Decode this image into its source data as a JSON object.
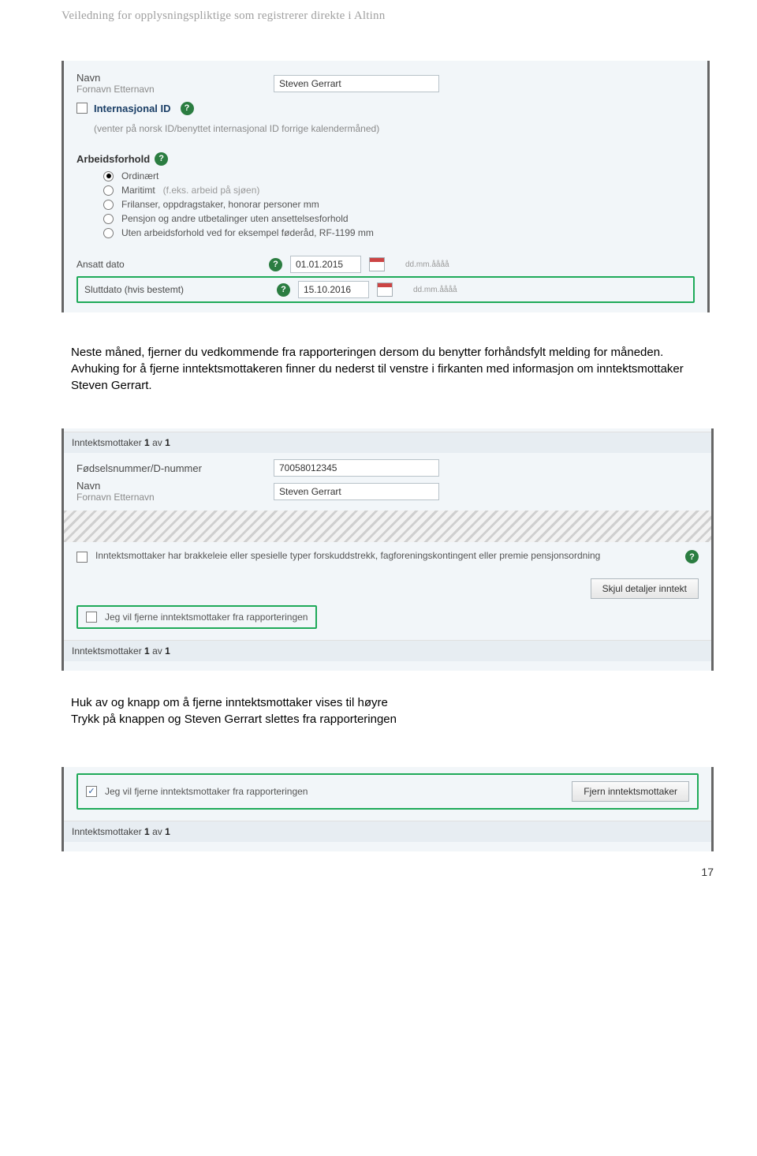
{
  "header": "Veiledning for opplysningspliktige som registrerer direkte i Altinn",
  "page_number": "17",
  "panel1": {
    "navn_label": "Navn",
    "navn_sub": "Fornavn Etternavn",
    "navn_value": "Steven Gerrart",
    "intl_id_label": "Internasjonal ID",
    "intl_id_hint": "(venter på norsk ID/benyttet internasjonal ID forrige kalendermåned)",
    "arbeid_label": "Arbeidsforhold",
    "radios": [
      {
        "label": "Ordinært",
        "hint": ""
      },
      {
        "label": "Maritimt",
        "hint": "(f.eks. arbeid på sjøen)"
      },
      {
        "label": "Frilanser, oppdragstaker, honorar personer mm",
        "hint": ""
      },
      {
        "label": "Pensjon og andre utbetalinger uten ansettelsesforhold",
        "hint": ""
      },
      {
        "label": "Uten arbeidsforhold ved for eksempel føderåd, RF-1199 mm",
        "hint": ""
      }
    ],
    "ansatt_label": "Ansatt dato",
    "ansatt_value": "01.01.2015",
    "slutt_label": "Sluttdato (hvis bestemt)",
    "slutt_value": "15.10.2016",
    "fmt_hint": "dd.mm.åååå"
  },
  "para1": "Neste måned, fjerner du vedkommende fra rapporteringen dersom du benytter forhåndsfylt melding for måneden.",
  "para2": "Avhuking for å fjerne inntektsmottakeren finner du nederst til venstre i firkanten med informasjon om inntektsmottaker Steven Gerrart.",
  "panel2": {
    "counter_prefix": "Inntektsmottaker ",
    "counter_mid": " av ",
    "counter_a": "1",
    "counter_b": "1",
    "fnr_label": "Fødselsnummer/D-nummer",
    "fnr_value": "70058012345",
    "navn_label": "Navn",
    "navn_sub": "Fornavn Etternavn",
    "navn_value": "Steven Gerrart",
    "brakkeleie": "Inntektsmottaker har brakkeleie eller spesielle typer forskuddstrekk, fagforeningskontingent eller premie pensjonsordning",
    "skjul_btn": "Skjul detaljer inntekt",
    "fjern_chk": "Jeg vil fjerne inntektsmottaker fra rapporteringen"
  },
  "para3": "Huk av og knapp om å fjerne inntektsmottaker vises til høyre",
  "para4": "Trykk på knappen og Steven Gerrart slettes fra rapporteringen",
  "panel3": {
    "fjern_chk": "Jeg vil fjerne inntektsmottaker fra rapporteringen",
    "fjern_btn": "Fjern inntektsmottaker",
    "counter_prefix": "Inntektsmottaker ",
    "counter_mid": " av ",
    "counter_a": "1",
    "counter_b": "1"
  }
}
